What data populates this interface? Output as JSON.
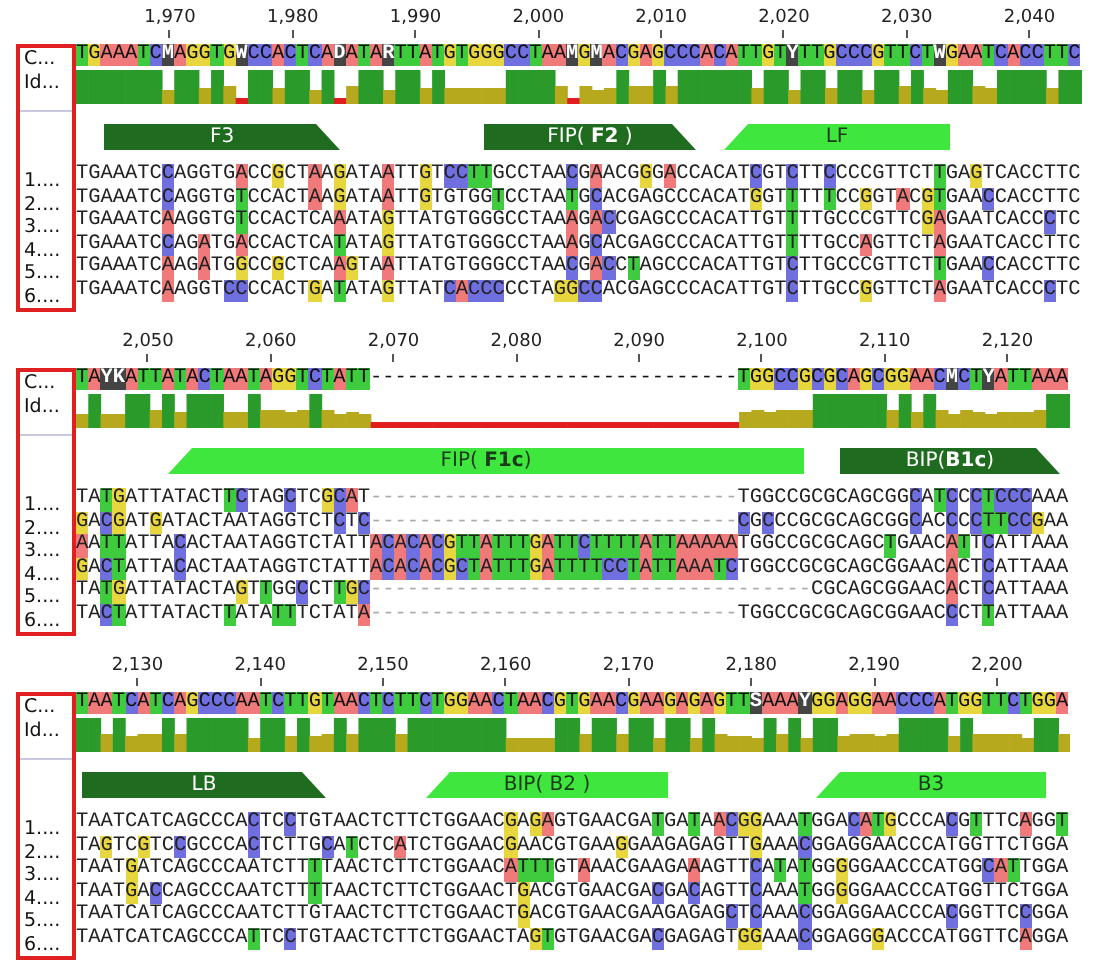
{
  "panels": [
    {
      "ruler": [
        "1,970",
        "1,980",
        "1,990",
        "2,000",
        "2,010",
        "2,020",
        "2,030",
        "2,040"
      ],
      "consensus": {
        "label": "C...",
        "bases": "TGAAATCMAGGTGWCCACTCADATARTTATGTGGGCCTAAMGMACGAGCCCACATTGTYTTGCCCGTTCTWGAATCACCTTC"
      },
      "identity": {
        "label": "Id..."
      },
      "annotations": [
        {
          "label": "F3",
          "kind": "forward",
          "color": "#1f6b1f"
        },
        {
          "label": "FIP( **F2** )",
          "kind": "forward",
          "color": "#1f6b1f"
        },
        {
          "label": "LF",
          "kind": "reverse",
          "color": "#3ee63e"
        }
      ],
      "sequences": [
        {
          "label": "1....",
          "bases": "TGAAATCCAGGTGACCGCTAAGATAATTGTCCTTGCCTAACGAACGGGACCACATCGTCTTCCCCGTTCTTGAGTCACCTTC"
        },
        {
          "label": "2....",
          "bases": "TGAAATCCAGGTGTCCACTAAGATAATTGTGTGGTCCTAATGCACGAGCCCACATGGTTTTTCCGGTACGTGAACCACCTTC"
        },
        {
          "label": "3....",
          "bases": "TGAAATCAAGGTGTCCACTCAAATAGTTATGTGGGCCTAAAGACCGAGCCCACATTGTTTTGCCCGTTCGAGAATCACCCTC"
        },
        {
          "label": "4....",
          "bases": "TGAAATCCAGATGACCACTCATATAGTTATGTGGGCCTAAAGCACGAGCCCACATTGTTTTGCCAGTTCTAGAATCACCTTC"
        },
        {
          "label": "5....",
          "bases": "TGAAATCAAGATGGCCGCTCAAGTAATTATGTGGGCCTAACGACCTAGCCCACATTGTCTTGCCCGTTCTTGAACCACCTTC"
        },
        {
          "label": "6....",
          "bases": "TGAAATCAAGGTCCCCACTGATATAGTTATCACCCCCTAGGCCACGAGCCCACATTGTCTTGCCGGTTCTAGAATCACCCTC"
        }
      ]
    },
    {
      "ruler": [
        "2,050",
        "2,060",
        "2,070",
        "2,080",
        "2,090",
        "2,100",
        "2,110",
        "2,120"
      ],
      "consensus": {
        "label": "C...",
        "bases": "TAYKATTATACTAATAGGTCTATT------------------------------TGGCCGCGCAGCGGAACMCTYATTAAA"
      },
      "identity": {
        "label": "Id..."
      },
      "annotations": [
        {
          "label": "FIP( **F1c**)",
          "kind": "reverse",
          "color": "#3ee63e"
        },
        {
          "label": "BIP(**B1c**)",
          "kind": "forward",
          "color": "#1f6b1f"
        }
      ],
      "sequences": [
        {
          "label": "1....",
          "bases": "TATGATTATACTTCTAGCTCGCAT------------------------------TGGCCGCGCAGCGGCATCCCTCCCAAA"
        },
        {
          "label": "2....",
          "bases": "GACGATGATACTAATAGGTCTCTC------------------------------CGCCCGCGCAGCGGCACCCCTTCCGAA"
        },
        {
          "label": "3....",
          "bases": "AATTATTACACTAATAGGTCTATTACACACGTTATTTGATTCTTTTATTAAAAATGGCCGCGCAGCTGAACATTCATTAAA"
        },
        {
          "label": "4....",
          "bases": "GACTATTACACTAATAGGTCTATTACACACGCTATTTGATTTTCCTATTAAATCTGGCCGCGCAGCGGAACACTCATTAAA"
        },
        {
          "label": "5....",
          "bases": "TATGATTATACTAGTTGGCCTTGC------------------------------------CGCAGCGGAACACTCATTAAA"
        },
        {
          "label": "6....",
          "bases": "TACTATTATACTTATATTTCTATA------------------------------TGGCCGCGCAGCGGAACCCTTATTAAA"
        }
      ]
    },
    {
      "ruler": [
        "2,130",
        "2,140",
        "2,150",
        "2,160",
        "2,170",
        "2,180",
        "2,190",
        "2,200"
      ],
      "consensus": {
        "label": "C...",
        "bases": "TAATCATCAGCCCAATCTTGTAACTCTTCTGGAACTAACGTGAACGAAGAGAGTTSAAAYGGAGGAACCCATGGTTCTGGA"
      },
      "identity": {
        "label": "Id..."
      },
      "annotations": [
        {
          "label": "LB",
          "kind": "forward",
          "color": "#1f6b1f"
        },
        {
          "label": "BIP( B2 )",
          "kind": "reverse",
          "color": "#3ee63e"
        },
        {
          "label": "B3",
          "kind": "reverse",
          "color": "#3ee63e"
        }
      ],
      "sequences": [
        {
          "label": "1....",
          "bases": "TAATCATCAGCCCACTCCTGTAACTCTTCTGGAACGAGAGTGAACGATGATAACGGAAATGGACATGCCCACGTTTCAGGT"
        },
        {
          "label": "2....",
          "bases": "TAGTCGTCCGCCCACTCTTGCATCTCATCTGGAACGAACGTGAAGGAAGAGAGTTGAAACGGAGGAACCCATGGTTCTGGA"
        },
        {
          "label": "3....",
          "bases": "TAATGATCAGCCCAATCTTTTAACTCTTCTGGAACATTTGTAAACGAAGAAAGTTCATATGGGGGAACCCATGGCATTGGA"
        },
        {
          "label": "4....",
          "bases": "TAATGACCAGCCCAATCTTTTAACTCTTCTGGAACTGACGTGAACGACGACAGTTCAAATGGGGGAACCCATGGTTCTGGA"
        },
        {
          "label": "5....",
          "bases": "TAATCATCAGCCCAATCTTGTAACTCTTCTGGAACTGACGTGAACGAAGAGAGCTCAAACGGAGGAACCCACGGTTCCGGA"
        },
        {
          "label": "6....",
          "bases": "TAATCATCAGCCCATTCCTGTAACTCTTCTGGAACTAGTGTGAACGACGAGAGTGGAAACGGAGGGACCCATGGTTCAGGA"
        }
      ]
    }
  ]
}
